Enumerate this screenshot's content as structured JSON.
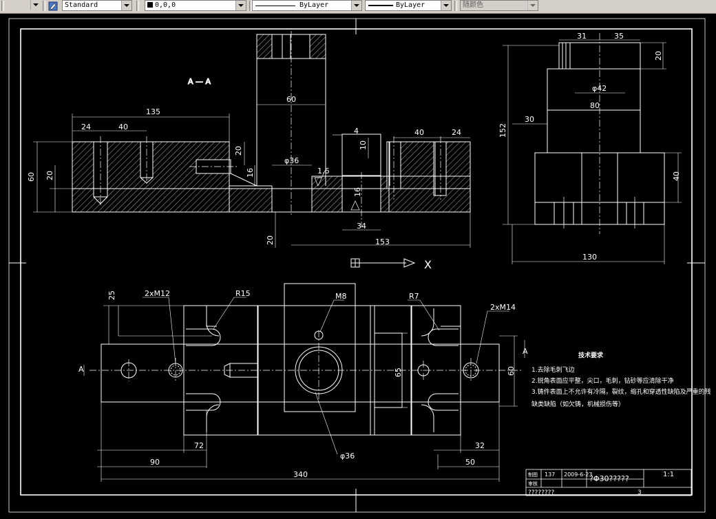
{
  "toolbar": {
    "text_style": "Standard",
    "color": "0,0,0",
    "linetype": "ByLayer",
    "lineweight": "ByLayer",
    "plotstyle": "随颜色"
  },
  "drawing": {
    "section_label": "A — A",
    "dims_top": {
      "d135": "135",
      "d24a": "24",
      "d40a": "40",
      "d60top": "60",
      "d20a": "20",
      "d16a": "16",
      "d60left": "60",
      "d20left": "20",
      "dphi36a": "φ36",
      "d16b": "1.6",
      "d4": "4",
      "d10": "10",
      "d40b": "40",
      "d24b": "24",
      "d34": "34",
      "d153": "153",
      "d20low": "20",
      "d16c": "16"
    },
    "dims_side": {
      "d31": "31",
      "d35": "35",
      "d20": "20",
      "dphi42": "φ42",
      "d80": "80",
      "d30": "30",
      "d152": "152",
      "d40": "40",
      "d130": "130"
    },
    "axis_x": "X",
    "dims_plan": {
      "d25": "25",
      "m12": "2xM12",
      "r15": "R15",
      "m8": "M8",
      "r7": "R7",
      "m14": "2xM14",
      "a_left": "A",
      "a_right": "A",
      "d65": "65",
      "d60": "60",
      "d72": "72",
      "d90": "90",
      "phi36": "φ36",
      "d32": "32",
      "d50": "50",
      "d340": "340"
    },
    "notes": {
      "title": "技术要求",
      "line1": "1.去除毛刺飞边",
      "line2": "2.锐角表面应平整，尖口，毛刺，钻砂等应清除干净",
      "line3": "3.铸件表面上不允许有冷隔，裂纹，缩孔和穿透性缺陷及严重的残",
      "line4": "缺类缺陷（如欠铸，机械损伤等）"
    },
    "title_block": {
      "label_draw": "制图",
      "label_check": "审核",
      "drawn_code": "137",
      "date": "2009-6-23",
      "part_name": "?Φ30?????",
      "scale": "1:1",
      "bottom_left": "????????",
      "sheet": "3"
    }
  }
}
